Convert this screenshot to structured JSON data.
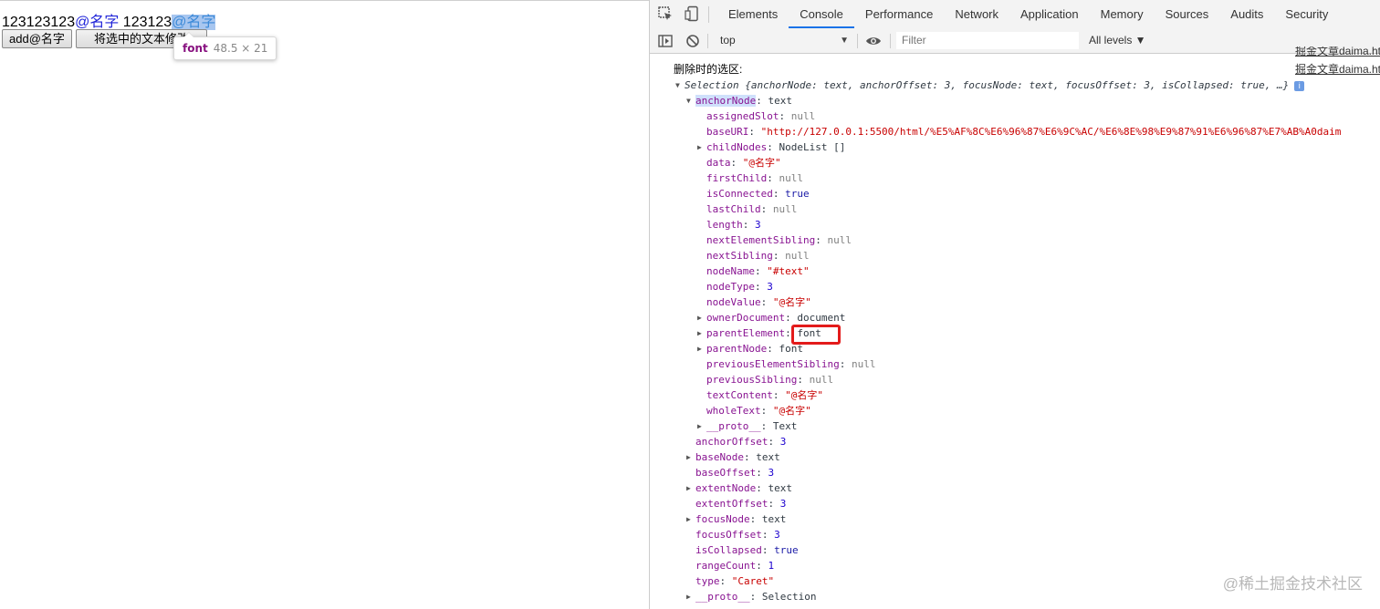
{
  "page": {
    "line1": {
      "prefix": "123123123",
      "mention1": "@名字",
      "middle": " 123123",
      "mention2_selected": "@名字"
    },
    "buttons": {
      "add": "add@名字",
      "modify": "将选中的文本修改"
    },
    "tooltip": {
      "tag": "font",
      "dims": "48.5 × 21"
    }
  },
  "devtools": {
    "tabs": [
      "Elements",
      "Console",
      "Performance",
      "Network",
      "Application",
      "Memory",
      "Sources",
      "Audits",
      "Security"
    ],
    "active_tab": "Console",
    "toolbar": {
      "context": "top",
      "filter_placeholder": "Filter",
      "levels": "All levels ▼"
    },
    "console": {
      "log_label": "删除时的选区:",
      "source_link_top": "掘金文章daima.ht",
      "source_link_main": "掘金文章daima.ht",
      "selection_summary": "Selection {anchorNode: text, anchorOffset: 3, focusNode: text, focusOffset: 3, isCollapsed: true, …}",
      "anchor_node_key": "anchorNode",
      "anchor_node_val": "text",
      "anchor_props": [
        {
          "k": "assignedSlot",
          "v": "null",
          "t": "null",
          "expand": false
        },
        {
          "k": "baseURI",
          "v": "\"http://127.0.0.1:5500/html/%E5%AF%8C%E6%96%87%E6%9C%AC/%E6%8E%98%E9%87%91%E6%96%87%E7%AB%A0daim",
          "t": "str",
          "expand": false
        },
        {
          "k": "childNodes",
          "v": "NodeList []",
          "t": "obj",
          "expand": true
        },
        {
          "k": "data",
          "v": "\"@名字\"",
          "t": "str",
          "expand": false
        },
        {
          "k": "firstChild",
          "v": "null",
          "t": "null",
          "expand": false
        },
        {
          "k": "isConnected",
          "v": "true",
          "t": "bool",
          "expand": false
        },
        {
          "k": "lastChild",
          "v": "null",
          "t": "null",
          "expand": false
        },
        {
          "k": "length",
          "v": "3",
          "t": "num",
          "expand": false
        },
        {
          "k": "nextElementSibling",
          "v": "null",
          "t": "null",
          "expand": false
        },
        {
          "k": "nextSibling",
          "v": "null",
          "t": "null",
          "expand": false
        },
        {
          "k": "nodeName",
          "v": "\"#text\"",
          "t": "str",
          "expand": false
        },
        {
          "k": "nodeType",
          "v": "3",
          "t": "num",
          "expand": false
        },
        {
          "k": "nodeValue",
          "v": "\"@名字\"",
          "t": "str",
          "expand": false
        },
        {
          "k": "ownerDocument",
          "v": "document",
          "t": "obj",
          "expand": true
        },
        {
          "k": "parentElement",
          "v": "font",
          "t": "obj",
          "expand": true
        },
        {
          "k": "parentNode",
          "v": "font",
          "t": "obj",
          "expand": true
        },
        {
          "k": "previousElementSibling",
          "v": "null",
          "t": "null",
          "expand": false
        },
        {
          "k": "previousSibling",
          "v": "null",
          "t": "null",
          "expand": false
        },
        {
          "k": "textContent",
          "v": "\"@名字\"",
          "t": "str",
          "expand": false
        },
        {
          "k": "wholeText",
          "v": "\"@名字\"",
          "t": "str",
          "expand": false
        },
        {
          "k": "__proto__",
          "v": "Text",
          "t": "obj",
          "expand": true
        }
      ],
      "selection_props": [
        {
          "k": "anchorOffset",
          "v": "3",
          "t": "num",
          "expand": false
        },
        {
          "k": "baseNode",
          "v": "text",
          "t": "obj",
          "expand": true
        },
        {
          "k": "baseOffset",
          "v": "3",
          "t": "num",
          "expand": false
        },
        {
          "k": "extentNode",
          "v": "text",
          "t": "obj",
          "expand": true
        },
        {
          "k": "extentOffset",
          "v": "3",
          "t": "num",
          "expand": false
        },
        {
          "k": "focusNode",
          "v": "text",
          "t": "obj",
          "expand": true
        },
        {
          "k": "focusOffset",
          "v": "3",
          "t": "num",
          "expand": false
        },
        {
          "k": "isCollapsed",
          "v": "true",
          "t": "bool",
          "expand": false
        },
        {
          "k": "rangeCount",
          "v": "1",
          "t": "num",
          "expand": false
        },
        {
          "k": "type",
          "v": "\"Caret\"",
          "t": "str",
          "expand": false
        },
        {
          "k": "__proto__",
          "v": "Selection",
          "t": "obj",
          "expand": true
        }
      ],
      "highlight_color": "#e31b1b"
    }
  },
  "watermark": "@稀土掘金技术社区"
}
